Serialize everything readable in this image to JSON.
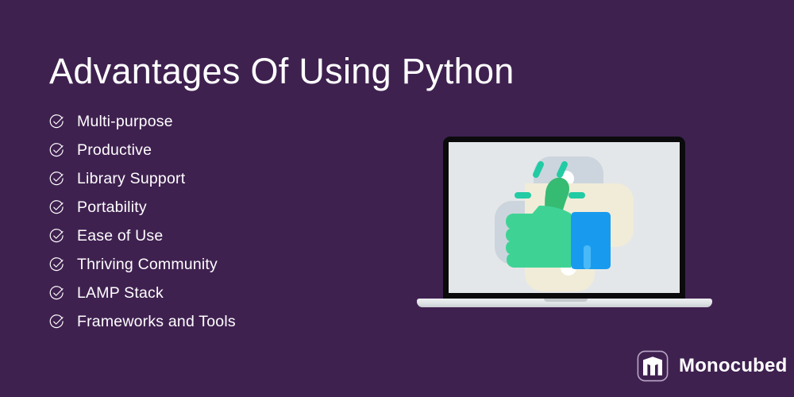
{
  "theme": {
    "background": "#3f2150",
    "text": "#ffffff",
    "screen_background": "#e4e7e9",
    "bezel": "#0b0b0d",
    "python_logo_blue_grey": "#ccd5dd",
    "python_logo_cream": "#f1ecd8",
    "thumb_green_light": "#3ed395",
    "thumb_green_dark": "#36bb72",
    "sleeve_blue": "#189bef",
    "sleeve_blue_light": "#4ab9f7",
    "spark_teal": "#22cba4"
  },
  "header": {
    "title": "Advantages Of Using Python"
  },
  "benefits": {
    "bullet_icon": "circle-check-icon",
    "items": [
      {
        "label": "Multi-purpose"
      },
      {
        "label": "Productive"
      },
      {
        "label": "Library Support"
      },
      {
        "label": "Portability"
      },
      {
        "label": "Ease of Use"
      },
      {
        "label": "Thriving Community"
      },
      {
        "label": "LAMP Stack"
      },
      {
        "label": "Frameworks and Tools"
      }
    ]
  },
  "illustration": {
    "name": "laptop-thumbs-up-illustration",
    "device": "laptop",
    "screen_content": "python-logo-watermark-with-thumbs-up",
    "icons": [
      "python-logo-icon",
      "thumbs-up-icon",
      "sparkle-icon"
    ]
  },
  "brand": {
    "mark_icon": "monocubed-cube-logo-icon",
    "name": "Monocubed"
  }
}
